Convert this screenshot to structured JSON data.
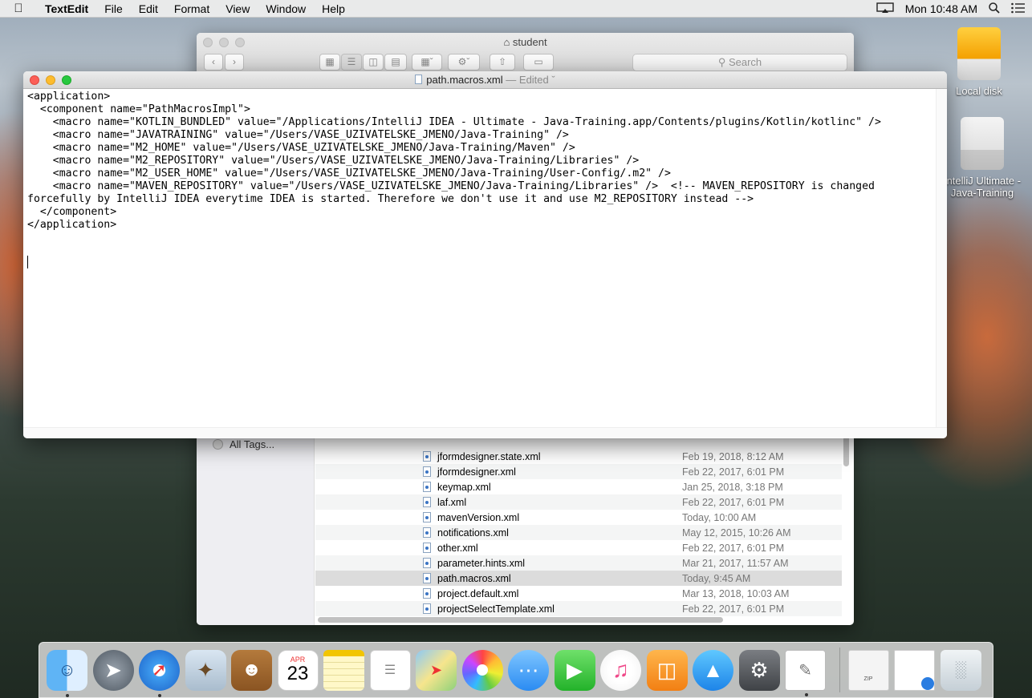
{
  "menubar": {
    "app": "TextEdit",
    "menus": [
      "File",
      "Edit",
      "Format",
      "View",
      "Window",
      "Help"
    ],
    "clock": "Mon 10:48 AM"
  },
  "desktop": {
    "icons": [
      {
        "label": "Local disk"
      },
      {
        "label": "IntelliJ Ultimate - Java-Training"
      }
    ]
  },
  "finder": {
    "title": "student",
    "search_placeholder": "Search",
    "sidebar_item": "All Tags...",
    "files": [
      {
        "name": "jformdesigner.state.xml",
        "date": "Feb 19, 2018, 8:12 AM"
      },
      {
        "name": "jformdesigner.xml",
        "date": "Feb 22, 2017, 6:01 PM"
      },
      {
        "name": "keymap.xml",
        "date": "Jan 25, 2018, 3:18 PM"
      },
      {
        "name": "laf.xml",
        "date": "Feb 22, 2017, 6:01 PM"
      },
      {
        "name": "mavenVersion.xml",
        "date": "Today, 10:00 AM"
      },
      {
        "name": "notifications.xml",
        "date": "May 12, 2015, 10:26 AM"
      },
      {
        "name": "other.xml",
        "date": "Feb 22, 2017, 6:01 PM"
      },
      {
        "name": "parameter.hints.xml",
        "date": "Mar 21, 2017, 11:57 AM"
      },
      {
        "name": "path.macros.xml",
        "date": "Today, 9:45 AM"
      },
      {
        "name": "project.default.xml",
        "date": "Mar 13, 2018, 10:03 AM"
      },
      {
        "name": "projectSelectTemplate.xml",
        "date": "Feb 22, 2017, 6:01 PM"
      }
    ]
  },
  "textedit": {
    "filename": "path.macros.xml",
    "status": "— Edited",
    "content": "<application>\n  <component name=\"PathMacrosImpl\">\n    <macro name=\"KOTLIN_BUNDLED\" value=\"/Applications/IntelliJ IDEA - Ultimate - Java-Training.app/Contents/plugins/Kotlin/kotlinc\" />\n    <macro name=\"JAVATRAINING\" value=\"/Users/VASE_UZIVATELSKE_JMENO/Java-Training\" />\n    <macro name=\"M2_HOME\" value=\"/Users/VASE_UZIVATELSKE_JMENO/Java-Training/Maven\" />\n    <macro name=\"M2_REPOSITORY\" value=\"/Users/VASE_UZIVATELSKE_JMENO/Java-Training/Libraries\" />\n    <macro name=\"M2_USER_HOME\" value=\"/Users/VASE_UZIVATELSKE_JMENO/Java-Training/User-Config/.m2\" />\n    <macro name=\"MAVEN_REPOSITORY\" value=\"/Users/VASE_UZIVATELSKE_JMENO/Java-Training/Libraries\" />  <!-- MAVEN_REPOSITORY is changed\nforcefully by IntelliJ IDEA everytime IDEA is started. Therefore we don't use it and use M2_REPOSITORY instead -->\n  </component>\n</application>"
  },
  "dock": {
    "calendar_month": "APR",
    "calendar_day": "23",
    "zip_label": "ZIP"
  },
  "colors": {
    "close": "#fc5f57",
    "minimize": "#fdbc2e",
    "zoom": "#28c840"
  }
}
